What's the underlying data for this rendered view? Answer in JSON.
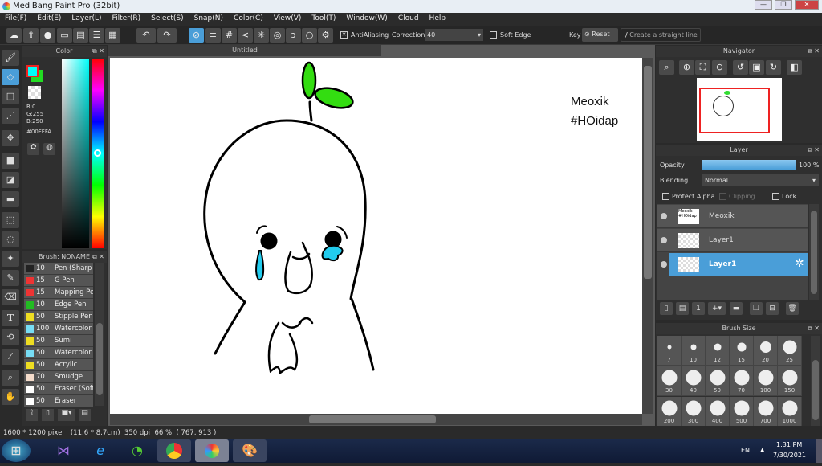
{
  "window": {
    "title": "MediBang Paint Pro (32bit)"
  },
  "menu": [
    "File(F)",
    "Edit(E)",
    "Layer(L)",
    "Filter(R)",
    "Select(S)",
    "Snap(N)",
    "Color(C)",
    "View(V)",
    "Tool(T)",
    "Window(W)",
    "Cloud",
    "Help"
  ],
  "toolbar": {
    "antialiasing_label": "AntiAliasing",
    "correction_label": "Correction",
    "correction_value": "40",
    "soft_edge_label": "Soft Edge",
    "key_label": "Key",
    "reset_label": "Reset",
    "straight_line_label": "Create a straight line"
  },
  "color_panel": {
    "title": "Color",
    "r": "R:0",
    "g": "G:255",
    "b": "B:250",
    "hex": "#00FFFA",
    "foreground": "#00FFFA",
    "background": "#22DD22"
  },
  "brush_panel": {
    "title": "Brush: NONAME",
    "items": [
      {
        "size": "10",
        "name": "Pen (Sharp",
        "color": "#222222"
      },
      {
        "size": "15",
        "name": "G Pen",
        "color": "#ee3333"
      },
      {
        "size": "15",
        "name": "Mapping Pe",
        "color": "#ee3333"
      },
      {
        "size": "10",
        "name": "Edge Pen",
        "color": "#22bb22"
      },
      {
        "size": "50",
        "name": "Stipple Pen",
        "color": "#eedd22"
      },
      {
        "size": "100",
        "name": "Watercolor",
        "color": "#77ddf5"
      },
      {
        "size": "50",
        "name": "Sumi",
        "color": "#eedd22"
      },
      {
        "size": "50",
        "name": "Watercolor",
        "color": "#77ddf5"
      },
      {
        "size": "50",
        "name": "Acrylic",
        "color": "#eedd22"
      },
      {
        "size": "70",
        "name": "Smudge",
        "color": "#f5dccb"
      },
      {
        "size": "50",
        "name": "Eraser (Soft",
        "color": "#ffffff"
      },
      {
        "size": "50",
        "name": "Eraser",
        "color": "#ffffff"
      }
    ]
  },
  "canvas": {
    "tab": "Untitled",
    "text_line1": "Meoxik",
    "text_line2": "#HOidap"
  },
  "navigator": {
    "title": "Navigator"
  },
  "layer_panel": {
    "title": "Layer",
    "opacity_label": "Opacity",
    "opacity_value": "100 %",
    "opacity": 100,
    "blending_label": "Blending",
    "blending_value": "Normal",
    "protect_alpha": "Protect Alpha",
    "clipping": "Clipping",
    "lock": "Lock",
    "layers": [
      {
        "name": "Meoxik",
        "thumb": "Meoxik #HOidap"
      },
      {
        "name": "Layer1"
      },
      {
        "name": "Layer1",
        "selected": true
      }
    ]
  },
  "brush_size": {
    "title": "Brush Size",
    "sizes": [
      "7",
      "10",
      "12",
      "15",
      "20",
      "25",
      "30",
      "40",
      "50",
      "70",
      "100",
      "150",
      "200",
      "300",
      "400",
      "500",
      "700",
      "1000"
    ]
  },
  "status": {
    "dimensions": "1600 * 1200 pixel",
    "physical": "(11.6 * 8.7cm)",
    "dpi": "350 dpi",
    "zoom": "66 %",
    "coords": "( 767, 913 )"
  },
  "taskbar": {
    "lang": "EN",
    "time": "1:31 PM",
    "date": "7/30/2021"
  }
}
